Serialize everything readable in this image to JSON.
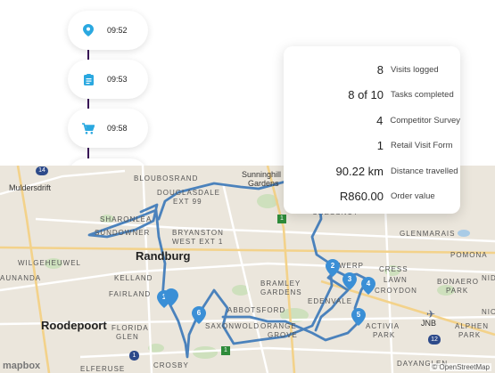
{
  "timeline": {
    "items": [
      {
        "icon": "map-pin-icon",
        "time": "09:52"
      },
      {
        "icon": "clipboard-icon",
        "time": "09:53"
      },
      {
        "icon": "cart-icon",
        "time": "09:58"
      }
    ]
  },
  "stats": [
    {
      "value": "8",
      "label": "Visits logged"
    },
    {
      "value": "8 of 10",
      "label": "Tasks completed"
    },
    {
      "value": "4",
      "label": "Competitor Survey"
    },
    {
      "value": "1",
      "label": "Retail Visit Form"
    },
    {
      "value": "90.22 km",
      "label": "Distance travelled"
    },
    {
      "value": "R860.00",
      "label": "Order value"
    }
  ],
  "map": {
    "places": {
      "muldersdrift": "Muldersdrift",
      "bloubosrand": "BLOUBOSRAND",
      "sunninghill": "Sunninghill",
      "gardens": "Gardens",
      "douglasdale": "DOUGLASDALE",
      "ext99": "EXT 99",
      "sharonlea": "SHARONLEA",
      "sundowner": "SUNDOWNER",
      "bryanston": "BRYANSTON",
      "bryanston_west": "WEST EXT 1",
      "randburg": "Randburg",
      "wilgeheuwel": "WILGEHEUWEL",
      "raunda": "AUNANDA",
      "kelland": "KELLAND",
      "fairland": "FAIRLAND",
      "roodepoort": "Roodepoort",
      "florida": "FLORIDA",
      "florida_glen": "GLEN",
      "bramley": "BRAMLEY",
      "bramley_gardens": "GARDENS",
      "abbotsford": "ABBOTSFORD",
      "saxonwold": "SAXONWOLD",
      "orange": "ORANGE",
      "grove": "GROVE",
      "edenvale": "EDENVALE",
      "cress": "CRESS",
      "lawn": "LAWN",
      "croydon": "CROYDON",
      "glenmarais": "GLENMARAIS",
      "pomona": "POMONA",
      "bonaero": "BONAERO",
      "park": "PARK",
      "activia": "ACTIVIA",
      "activia_park": "PARK",
      "jnb": "JNB",
      "alphen": "ALPHEN",
      "alphen_park": "PARK",
      "crosby": "CROSBY",
      "elferuse": "ELFERUSE",
      "dayanglen": "DAYANGLEN",
      "chestnut": "CHESSNUT",
      "werp": "WERP",
      "nid": "NID",
      "nio": "NIO"
    },
    "markers": [
      "1",
      "2",
      "3",
      "4",
      "5",
      "6"
    ],
    "road_badges": [
      "14",
      "1",
      "1",
      "12",
      "1"
    ],
    "logo": "mapbox",
    "attribution": "© OpenStreetMap"
  },
  "colors": {
    "route": "#3d7ab8",
    "marker": "#3a8fd6",
    "accent": "#2aa8e0",
    "timeline_line": "#3a1458"
  }
}
